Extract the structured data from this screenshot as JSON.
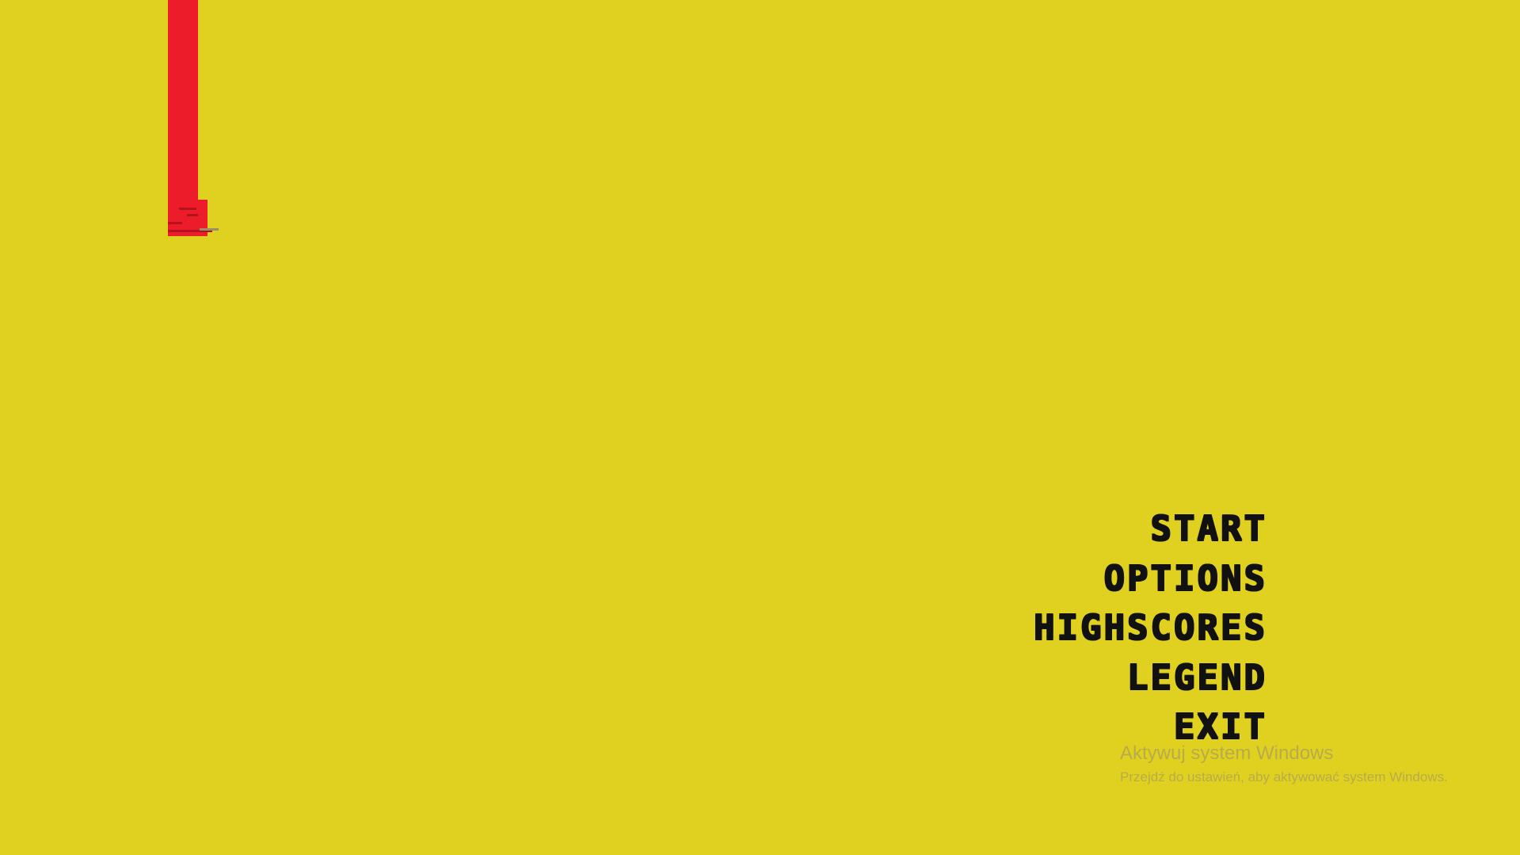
{
  "colors": {
    "background": "#E0D120",
    "bar": "#EC1C2B",
    "bar_dark": "#B5121F",
    "menu_text": "#111111",
    "watermark_text": "#B8AB4A"
  },
  "menu": {
    "items": [
      {
        "label": "START"
      },
      {
        "label": "OPTIONS"
      },
      {
        "label": "HIGHSCORES"
      },
      {
        "label": "LEGEND"
      },
      {
        "label": "EXIT"
      }
    ]
  },
  "watermark": {
    "title": "Aktywuj system Windows",
    "subtitle": "Przejdź do ustawień, aby aktywować system Windows."
  }
}
